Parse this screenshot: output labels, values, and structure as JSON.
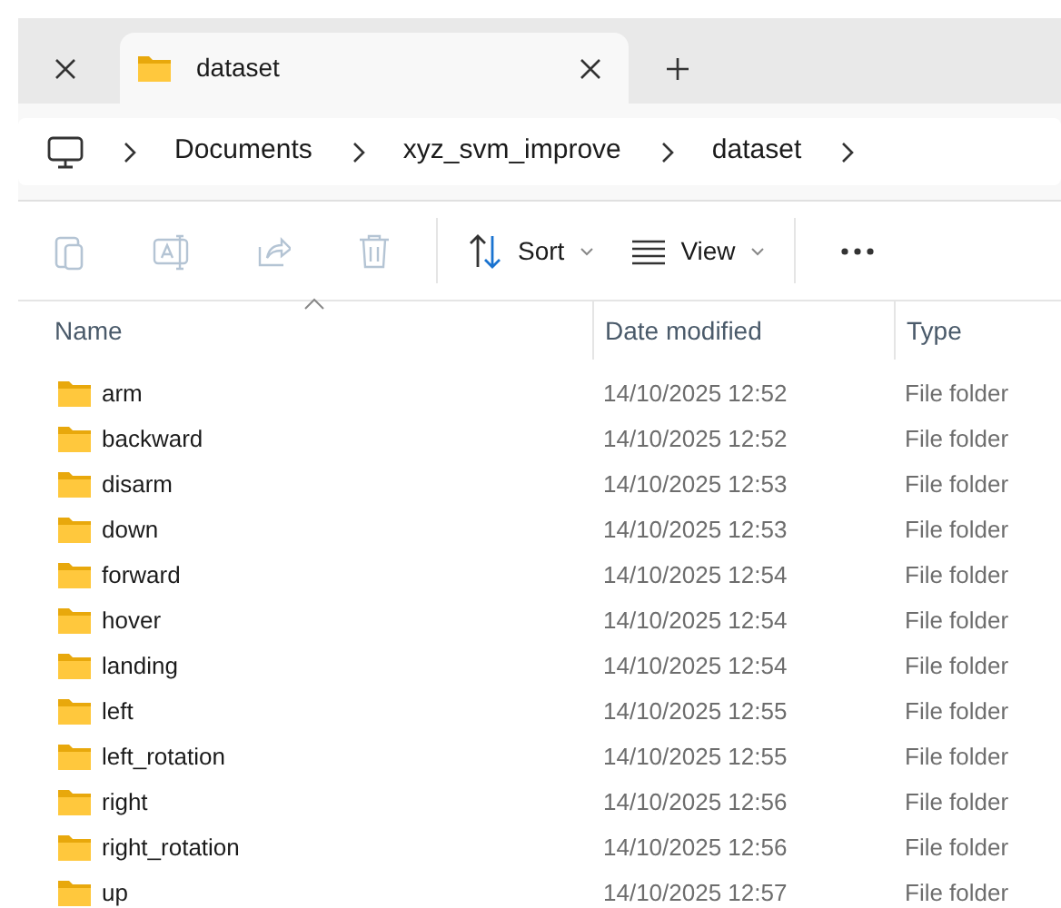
{
  "tabs": [
    {
      "selected": false
    },
    {
      "label": "dataset",
      "selected": true
    }
  ],
  "breadcrumb": [
    "Documents",
    "xyz_svm_improve",
    "dataset"
  ],
  "toolbar": [
    {
      "kind": "copy",
      "disabled": true
    },
    {
      "kind": "rename",
      "disabled": true
    },
    {
      "kind": "share",
      "disabled": true
    },
    {
      "kind": "delete",
      "disabled": true
    },
    {
      "kind": "sort",
      "label": "Sort",
      "disabled": false
    },
    {
      "kind": "view",
      "label": "View",
      "disabled": false
    },
    {
      "kind": "more",
      "disabled": false
    }
  ],
  "columns": [
    "Name",
    "Date modified",
    "Type"
  ],
  "rows": [
    {
      "name": "arm",
      "date": "14/10/2025 12:52",
      "type": "File folder"
    },
    {
      "name": "backward",
      "date": "14/10/2025 12:52",
      "type": "File folder"
    },
    {
      "name": "disarm",
      "date": "14/10/2025 12:53",
      "type": "File folder"
    },
    {
      "name": "down",
      "date": "14/10/2025 12:53",
      "type": "File folder"
    },
    {
      "name": "forward",
      "date": "14/10/2025 12:54",
      "type": "File folder"
    },
    {
      "name": "hover",
      "date": "14/10/2025 12:54",
      "type": "File folder"
    },
    {
      "name": "landing",
      "date": "14/10/2025 12:54",
      "type": "File folder"
    },
    {
      "name": "left",
      "date": "14/10/2025 12:55",
      "type": "File folder"
    },
    {
      "name": "left_rotation",
      "date": "14/10/2025 12:55",
      "type": "File folder"
    },
    {
      "name": "right",
      "date": "14/10/2025 12:56",
      "type": "File folder"
    },
    {
      "name": "right_rotation",
      "date": "14/10/2025 12:56",
      "type": "File folder"
    },
    {
      "name": "up",
      "date": "14/10/2025 12:57",
      "type": "File folder"
    }
  ]
}
